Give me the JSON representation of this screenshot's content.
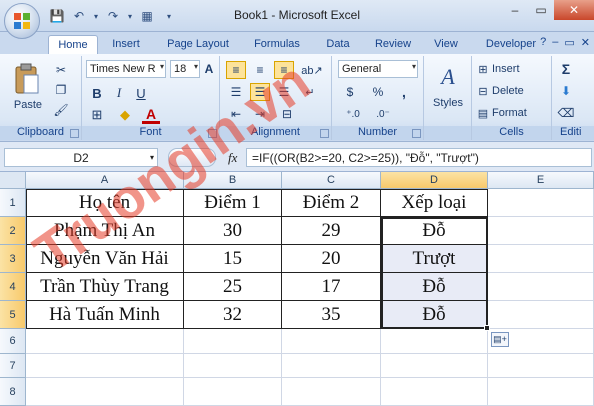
{
  "window": {
    "title": "Book1 - Microsoft Excel",
    "controls": {
      "minimize": "–",
      "restore": "▭",
      "close": "✕"
    }
  },
  "tabs": [
    {
      "label": "Home",
      "active": true
    },
    {
      "label": "Insert"
    },
    {
      "label": "Page Layout"
    },
    {
      "label": "Formulas"
    },
    {
      "label": "Data"
    },
    {
      "label": "Review"
    },
    {
      "label": "View"
    },
    {
      "label": "Developer"
    }
  ],
  "ribbon": {
    "clipboard": {
      "label": "Clipboard",
      "paste": "Paste"
    },
    "font": {
      "label": "Font",
      "font_name": "Times New R",
      "font_size": "18",
      "bold": "B",
      "italic": "I",
      "underline": "U",
      "font_color_glyph": "A"
    },
    "alignment": {
      "label": "Alignment"
    },
    "number": {
      "label": "Number",
      "format": "General",
      "currency": "$",
      "percent": "%",
      "comma": ","
    },
    "styles": {
      "label": "Styles"
    },
    "cells": {
      "label": "Cells",
      "insert": "Insert",
      "delete": "Delete",
      "format": "Format"
    },
    "editing": {
      "label": "Editi",
      "sum": "Σ"
    }
  },
  "formula_bar": {
    "name_box": "D2",
    "fx": "fx",
    "formula": "=IF((OR(B2>=20, C2>=25)), \"Đỗ\", \"Trượt\")"
  },
  "grid": {
    "columns": [
      "A",
      "B",
      "C",
      "D",
      "E"
    ],
    "rows": [
      "1",
      "2",
      "3",
      "4",
      "5",
      "6",
      "7",
      "8"
    ],
    "cells": [
      [
        "Họ tên",
        "Điểm 1",
        "Điểm 2",
        "Xếp loại"
      ],
      [
        "Phạm Thị An",
        "30",
        "29",
        "Đỗ"
      ],
      [
        "Nguyễn Văn Hải",
        "15",
        "20",
        "Trượt"
      ],
      [
        "Trần Thùy Trang",
        "25",
        "17",
        "Đỗ"
      ],
      [
        "Hà Tuấn Minh",
        "32",
        "35",
        "Đỗ"
      ]
    ]
  },
  "watermark": {
    "text": "Truongin.vn"
  },
  "colors": {
    "accent": "#15428b",
    "selection_header": "#f8c96b",
    "selected_fill": "#e8ebf6",
    "watermark": "#e63c28"
  }
}
